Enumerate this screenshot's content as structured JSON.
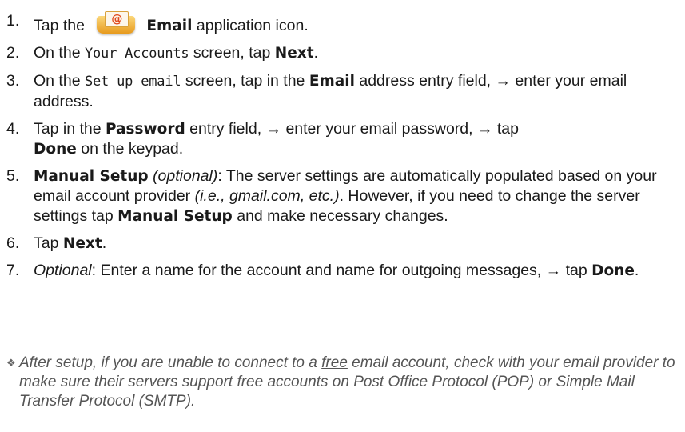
{
  "steps": [
    {
      "num": "1.",
      "a": "Tap the",
      "icon": "email-app-icon",
      "icon_glyph": "@",
      "b": "Email",
      "c": "application icon."
    },
    {
      "num": "2.",
      "a": "On the",
      "mono": "Your Accounts",
      "b": "screen, tap",
      "bold": "Next",
      "c": "."
    },
    {
      "num": "3.",
      "a": "On the",
      "mono": "Set up email",
      "b": "screen, tap in the",
      "bold": "Email",
      "c": "address entry field, → enter your email address."
    },
    {
      "num": "4.",
      "a": "Tap in the",
      "bold": "Password",
      "b": "entry field, → enter your email password, → tap",
      "bold2": "Done",
      "c": "on the keypad."
    },
    {
      "num": "5.",
      "bold": "Manual Setup",
      "ital": "(optional)",
      "a": ": The server settings are automatically populated based on your email account provider",
      "ital2": "(i.e., gmail.com, etc.)",
      "b": ". However, if you need to change the server settings tap",
      "bold2": "Manual Setup",
      "c": "and make necessary changes."
    },
    {
      "num": "6.",
      "a": "Tap",
      "bold": "Next",
      "c": "."
    },
    {
      "num": "7.",
      "ital": "Optional",
      "a": ": Enter a name for the account and name for outgoing messages, → tap",
      "bold": "Done",
      "c": "."
    }
  ],
  "note": {
    "bullet": "❖",
    "a": "After setup, if you are unable to connect to a",
    "u": "free",
    "b": "email account, check with your email provider to make sure their servers support free accounts on Post Office Protocol (POP) or Simple Mail Transfer Protocol (SMTP)."
  }
}
